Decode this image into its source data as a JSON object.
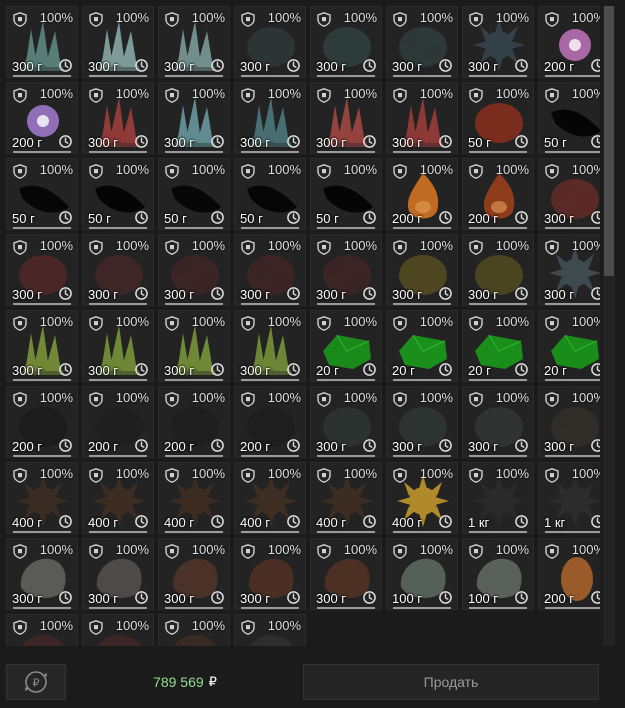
{
  "grid": {
    "items": [
      {
        "percent": "100%",
        "weight": "300 г",
        "art": "crystal",
        "color": "#5f8f86",
        "line": "#9a9a9a"
      },
      {
        "percent": "100%",
        "weight": "300 г",
        "art": "crystal",
        "color": "#8cb0ad",
        "line": "#9a9a9a"
      },
      {
        "percent": "100%",
        "weight": "300 г",
        "art": "crystal",
        "color": "#7fa19d",
        "line": "#9a9a9a"
      },
      {
        "percent": "100%",
        "weight": "300 г",
        "art": "blob",
        "color": "#2d3436",
        "line": "#9a9a9a"
      },
      {
        "percent": "100%",
        "weight": "300 г",
        "art": "blob",
        "color": "#2e3b3b",
        "line": "#9a9a9a"
      },
      {
        "percent": "100%",
        "weight": "300 г",
        "art": "blob",
        "color": "#2d3838",
        "line": "#9a9a9a"
      },
      {
        "percent": "100%",
        "weight": "300 г",
        "art": "spiky",
        "color": "#344047",
        "line": "#9a9a9a"
      },
      {
        "percent": "100%",
        "weight": "200 г",
        "art": "orb",
        "color": "#b86fb5",
        "line": "#9a9a9a"
      },
      {
        "percent": "100%",
        "weight": "200 г",
        "art": "orb",
        "color": "#9d78c9",
        "line": "#9a9a9a"
      },
      {
        "percent": "100%",
        "weight": "300 г",
        "art": "crystal",
        "color": "#a3403c",
        "line": "#9a9a9a"
      },
      {
        "percent": "100%",
        "weight": "300 г",
        "art": "crystal",
        "color": "#6a9ea5",
        "line": "#9a9a9a"
      },
      {
        "percent": "100%",
        "weight": "300 г",
        "art": "crystal",
        "color": "#4e7c82",
        "line": "#9a9a9a"
      },
      {
        "percent": "100%",
        "weight": "300 г",
        "art": "crystal",
        "color": "#a84843",
        "line": "#9a9a9a"
      },
      {
        "percent": "100%",
        "weight": "300 г",
        "art": "crystal",
        "color": "#a23e3a",
        "line": "#9a9a9a"
      },
      {
        "percent": "100%",
        "weight": "50 г",
        "art": "blob",
        "color": "#7a2d1c",
        "line": "#9a9a9a"
      },
      {
        "percent": "100%",
        "weight": "50 г",
        "art": "feather",
        "color": "#050505",
        "line": "#9a9a9a"
      },
      {
        "percent": "100%",
        "weight": "50 г",
        "art": "feather",
        "color": "#060606",
        "line": "#9a9a9a"
      },
      {
        "percent": "100%",
        "weight": "50 г",
        "art": "feather",
        "color": "#050505",
        "line": "#9a9a9a"
      },
      {
        "percent": "100%",
        "weight": "50 г",
        "art": "feather",
        "color": "#070707",
        "line": "#9a9a9a"
      },
      {
        "percent": "100%",
        "weight": "50 г",
        "art": "feather",
        "color": "#060606",
        "line": "#9a9a9a"
      },
      {
        "percent": "100%",
        "weight": "50 г",
        "art": "feather",
        "color": "#050505",
        "line": "#9a9a9a"
      },
      {
        "percent": "100%",
        "weight": "200 г",
        "art": "flame",
        "color": "#c06a22",
        "line": "#9a9a9a"
      },
      {
        "percent": "100%",
        "weight": "200 г",
        "art": "flame",
        "color": "#8e3c1c",
        "line": "#9a9a9a"
      },
      {
        "percent": "100%",
        "weight": "300 г",
        "art": "blob",
        "color": "#5a2a26",
        "line": "#9a9a9a"
      },
      {
        "percent": "100%",
        "weight": "300 г",
        "art": "blob",
        "color": "#4a2626",
        "line": "#9a9a9a"
      },
      {
        "percent": "100%",
        "weight": "300 г",
        "art": "blob",
        "color": "#3e2626",
        "line": "#9a9a9a"
      },
      {
        "percent": "100%",
        "weight": "300 г",
        "art": "blob",
        "color": "#3a2424",
        "line": "#9a9a9a"
      },
      {
        "percent": "100%",
        "weight": "300 г",
        "art": "blob",
        "color": "#3a2424",
        "line": "#9a9a9a"
      },
      {
        "percent": "100%",
        "weight": "300 г",
        "art": "blob",
        "color": "#3b2424",
        "line": "#9a9a9a"
      },
      {
        "percent": "100%",
        "weight": "300 г",
        "art": "blob",
        "color": "#4e4620",
        "line": "#9a9a9a"
      },
      {
        "percent": "100%",
        "weight": "300 г",
        "art": "blob",
        "color": "#4a4420",
        "line": "#9a9a9a"
      },
      {
        "percent": "100%",
        "weight": "300 г",
        "art": "spiky",
        "color": "#3e4a50",
        "line": "#9a9a9a"
      },
      {
        "percent": "100%",
        "weight": "300 г",
        "art": "crystal",
        "color": "#7f9a3b",
        "line": "#9a9a9a"
      },
      {
        "percent": "100%",
        "weight": "300 г",
        "art": "crystal",
        "color": "#7c9a3a",
        "line": "#9a9a9a"
      },
      {
        "percent": "100%",
        "weight": "300 г",
        "art": "crystal",
        "color": "#7d9a3b",
        "line": "#9a9a9a"
      },
      {
        "percent": "100%",
        "weight": "300 г",
        "art": "crystal",
        "color": "#7a983a",
        "line": "#9a9a9a"
      },
      {
        "percent": "100%",
        "weight": "20 г",
        "art": "gem",
        "color": "#1a8a1a",
        "line": "#9a9a9a"
      },
      {
        "percent": "100%",
        "weight": "20 г",
        "art": "gem",
        "color": "#1b8f1b",
        "line": "#9a9a9a"
      },
      {
        "percent": "100%",
        "weight": "20 г",
        "art": "gem",
        "color": "#1a8e1a",
        "line": "#9a9a9a"
      },
      {
        "percent": "100%",
        "weight": "20 г",
        "art": "gem",
        "color": "#1a8c1a",
        "line": "#9a9a9a"
      },
      {
        "percent": "100%",
        "weight": "200 г",
        "art": "blob",
        "color": "#1c1c1c",
        "line": "#9a9a9a"
      },
      {
        "percent": "100%",
        "weight": "200 г",
        "art": "blob",
        "color": "#1f1f1f",
        "line": "#9a9a9a"
      },
      {
        "percent": "100%",
        "weight": "200 г",
        "art": "blob",
        "color": "#1e1e1e",
        "line": "#9a9a9a"
      },
      {
        "percent": "100%",
        "weight": "200 г",
        "art": "blob",
        "color": "#1e1e1e",
        "line": "#9a9a9a"
      },
      {
        "percent": "100%",
        "weight": "300 г",
        "art": "blob",
        "color": "#2c3230",
        "line": "#9a9a9a"
      },
      {
        "percent": "100%",
        "weight": "300 г",
        "art": "blob",
        "color": "#2d3331",
        "line": "#9a9a9a"
      },
      {
        "percent": "100%",
        "weight": "300 г",
        "art": "blob",
        "color": "#2f3432",
        "line": "#9a9a9a"
      },
      {
        "percent": "100%",
        "weight": "300 г",
        "art": "blob",
        "color": "#302e28",
        "line": "#9a9a9a"
      },
      {
        "percent": "100%",
        "weight": "400 г",
        "art": "spiky",
        "color": "#3a2c22",
        "line": "#9a9a9a"
      },
      {
        "percent": "100%",
        "weight": "400 г",
        "art": "spiky",
        "color": "#3c2c22",
        "line": "#9a9a9a"
      },
      {
        "percent": "100%",
        "weight": "400 г",
        "art": "spiky",
        "color": "#3b2b21",
        "line": "#9a9a9a"
      },
      {
        "percent": "100%",
        "weight": "400 г",
        "art": "spiky",
        "color": "#3d2d22",
        "line": "#9a9a9a"
      },
      {
        "percent": "100%",
        "weight": "400 г",
        "art": "spiky",
        "color": "#3c2c21",
        "line": "#9a9a9a"
      },
      {
        "percent": "100%",
        "weight": "400 г",
        "art": "spiky",
        "color": "#b08a2a",
        "line": "#9a9a9a"
      },
      {
        "percent": "100%",
        "weight": "1 кг",
        "art": "spiky",
        "color": "#2a2a2a",
        "line": "#9a9a9a"
      },
      {
        "percent": "100%",
        "weight": "1 кг",
        "art": "spiky",
        "color": "#2c2c2c",
        "line": "#9a9a9a"
      },
      {
        "percent": "100%",
        "weight": "300 г",
        "art": "rock",
        "color": "#5a5a58",
        "line": "#9a9a9a"
      },
      {
        "percent": "100%",
        "weight": "300 г",
        "art": "rock",
        "color": "#4e4a48",
        "line": "#9a9a9a"
      },
      {
        "percent": "100%",
        "weight": "300 г",
        "art": "rock",
        "color": "#4a3228",
        "line": "#9a9a9a"
      },
      {
        "percent": "100%",
        "weight": "300 г",
        "art": "rock",
        "color": "#4a2e24",
        "line": "#9a9a9a"
      },
      {
        "percent": "100%",
        "weight": "300 г",
        "art": "rock",
        "color": "#4c3024",
        "line": "#9a9a9a"
      },
      {
        "percent": "100%",
        "weight": "100 г",
        "art": "rock",
        "color": "#56605a",
        "line": "#9a9a9a"
      },
      {
        "percent": "100%",
        "weight": "100 г",
        "art": "rock",
        "color": "#5a605c",
        "line": "#9a9a9a"
      },
      {
        "percent": "100%",
        "weight": "200 г",
        "art": "egg",
        "color": "#9a5a2a",
        "line": "#9a9a9a"
      },
      {
        "percent": "100%",
        "weight": "",
        "art": "blob",
        "color": "#3e2626",
        "line": "#9a9a9a"
      },
      {
        "percent": "100%",
        "weight": "",
        "art": "blob",
        "color": "#3c2626",
        "line": "#9a9a9a"
      },
      {
        "percent": "100%",
        "weight": "",
        "art": "blob",
        "color": "#3a2a24",
        "line": "#9a9a9a"
      },
      {
        "percent": "100%",
        "weight": "",
        "art": "blob",
        "color": "#2e2e2e",
        "line": "#9a9a9a"
      }
    ]
  },
  "footer": {
    "balance": "789 569",
    "currency": "₽",
    "sell_label": "Продать",
    "currency_icon": "ruble-cycle-icon"
  },
  "colors": {
    "balance_green": "#8fe08f",
    "background": "#1b1b1b",
    "cell_bg": "#232323"
  }
}
